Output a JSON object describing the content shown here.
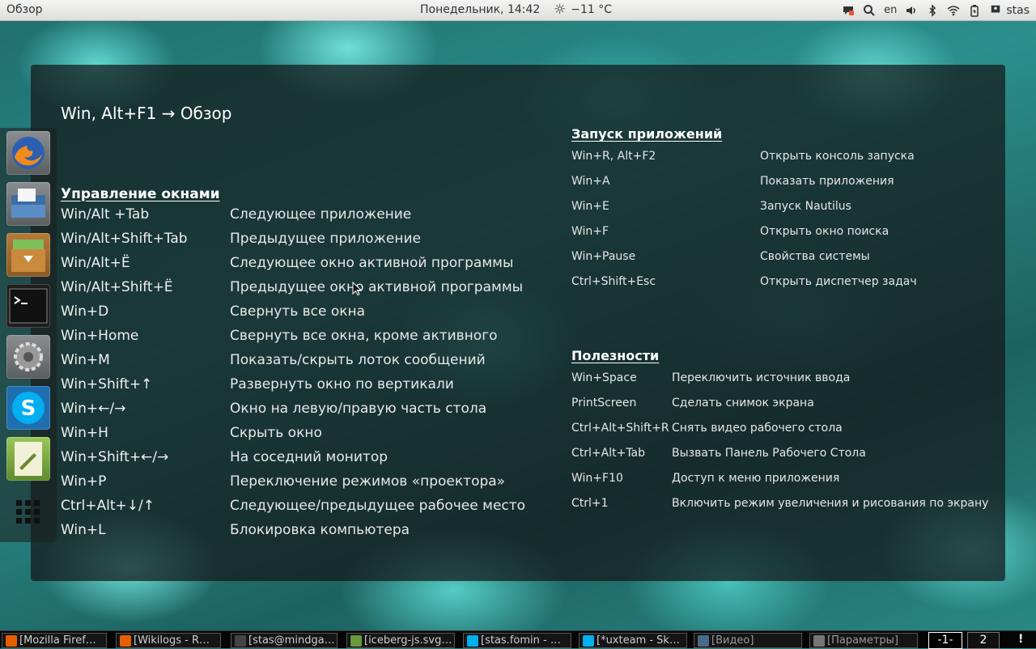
{
  "topbar": {
    "activities": "Обзор",
    "clock": "Понедельник, 14:42",
    "weather": "−11 °C",
    "keyboard_layout": "en",
    "user": "stas",
    "icons": [
      "chat-icon",
      "search-icon",
      "volume-icon",
      "bluetooth-icon",
      "wifi-icon",
      "battery-icon",
      "user-icon"
    ]
  },
  "overlay": {
    "title": "Win, Alt+F1 → Обзор",
    "window_section": {
      "heading": "Управление окнами",
      "rows": [
        {
          "key": "Win/Alt +Tab",
          "desc": "Следующее приложение"
        },
        {
          "key": "Win/Alt+Shift+Tab",
          "desc": "Предыдущее приложение"
        },
        {
          "key": "Win/Alt+Ё",
          "desc": "Следующее окно активной программы"
        },
        {
          "key": "Win/Alt+Shift+Ё",
          "desc": "Предыдущее окно активной программы"
        },
        {
          "key": "Win+D",
          "desc": "Свернуть все окна"
        },
        {
          "key": "Win+Home",
          "desc": "Свернуть все окна, кроме активного"
        },
        {
          "key": "Win+M",
          "desc": "Показать/скрыть лоток сообщений"
        },
        {
          "key": "Win+Shift+↑",
          "desc": "Развернуть окно по вертикали"
        },
        {
          "key": "Win+←/→",
          "desc": "Окно на левую/правую часть стола"
        },
        {
          "key": "Win+H",
          "desc": "Скрыть окно"
        },
        {
          "key": "Win+Shift+←/→",
          "desc": "На соседний монитор"
        },
        {
          "key": "Win+P",
          "desc": "Переключение режимов «проектора»"
        },
        {
          "key": "Ctrl+Alt+↓/↑",
          "desc": "Следующее/предыдущее рабочее место"
        },
        {
          "key": "Win+L",
          "desc": "Блокировка компьютера"
        }
      ]
    },
    "apps_section": {
      "heading": "Запуск приложений",
      "rows": [
        {
          "key": "Win+R, Alt+F2",
          "desc": "Открыть консоль запуска"
        },
        {
          "key": "Win+A",
          "desc": "Показать приложения"
        },
        {
          "key": "Win+E",
          "desc": "Запуск Nautilus"
        },
        {
          "key": "Win+F",
          "desc": "Открыть окно поиска"
        },
        {
          "key": "Win+Pause",
          "desc": "Свойства системы"
        },
        {
          "key": "Ctrl+Shift+Esc",
          "desc": "Открыть диспетчер задач"
        }
      ]
    },
    "utils_section": {
      "heading": "Полезности",
      "rows": [
        {
          "key": "Win+Space",
          "desc": "Переключить источник ввода"
        },
        {
          "key": "PrintScreen",
          "desc": "Сделать снимок экрана"
        },
        {
          "key": "Ctrl+Alt+Shift+R",
          "desc": "Снять видео рабочего стола"
        },
        {
          "key": "Ctrl+Alt+Tab",
          "desc": "Вызвать Панель Рабочего Стола"
        },
        {
          "key": "Win+F10",
          "desc": "Доступ к меню приложения"
        },
        {
          "key": "Ctrl+1",
          "desc": "Включить режим увеличения и рисования по экрану"
        }
      ]
    }
  },
  "dock": {
    "items": [
      "firefox-icon",
      "file-manager-icon",
      "archive-icon",
      "terminal-icon",
      "settings-icon",
      "skype-icon",
      "text-editor-icon",
      "show-apps-icon"
    ]
  },
  "taskbar": {
    "tasks": [
      {
        "label": "[Mozilla Firef…",
        "icon": "firefox-icon",
        "color": "#e66000"
      },
      {
        "label": "[Wikilogs - R…",
        "icon": "firefox-icon",
        "color": "#e66000"
      },
      {
        "label": "[stas@mindga…",
        "icon": "terminal-icon",
        "color": "#444444"
      },
      {
        "label": "[iceberg-js.svg…",
        "icon": "image-icon",
        "color": "#6a9a3a"
      },
      {
        "label": "[stas.fomin - …",
        "icon": "skype-icon",
        "color": "#00aff0"
      },
      {
        "label": "[*uxteam - Sk…",
        "icon": "skype-icon",
        "color": "#00aff0"
      },
      {
        "label": "[Видео]",
        "icon": "video-icon",
        "color": "#4a6a8a"
      },
      {
        "label": "[Параметры]",
        "icon": "settings-icon",
        "color": "#777777"
      }
    ],
    "workspaces": [
      "-1-",
      "2"
    ],
    "notification": "!"
  }
}
